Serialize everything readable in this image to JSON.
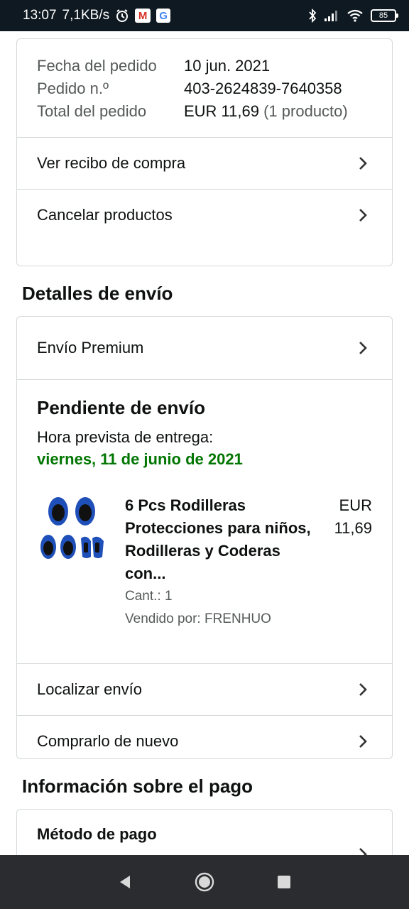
{
  "status_bar": {
    "time": "13:07",
    "speed": "7,1KB/s",
    "battery": "85",
    "icons": [
      "alarm-icon",
      "gmail-icon",
      "google-icon",
      "bluetooth-icon",
      "signal-icon",
      "wifi-icon",
      "battery-icon"
    ]
  },
  "order": {
    "date_label": "Fecha del pedido",
    "date_value": "10 jun. 2021",
    "number_label": "Pedido n.º",
    "number_value": "403-2624839-7640358",
    "total_label": "Total del pedido",
    "total_value": "EUR 11,69",
    "total_count": "(1 producto)",
    "links": [
      "Ver recibo de compra",
      "Cancelar productos"
    ]
  },
  "shipping": {
    "section_title": "Detalles de envío",
    "premium_label": "Envío Premium",
    "status": "Pendiente de envío",
    "delivery_label": "Hora prevista de entrega:",
    "delivery_date": "viernes, 11 de junio de 2021",
    "item": {
      "title": "6 Pcs Rodilleras Protecciones para niños, Rodilleras y Coderas con...",
      "quantity": "Cant.: 1",
      "seller": "Vendido por: FRENHUO",
      "price_currency": "EUR",
      "price_value": "11,69"
    },
    "links": [
      "Localizar envío",
      "Comprarlo de nuevo"
    ]
  },
  "payment": {
    "section_title": "Información sobre el pago",
    "method_label": "Método de pago"
  },
  "colors": {
    "accent_green": "#007600",
    "text": "#0f1111",
    "muted": "#565959",
    "border": "#d5d9d9",
    "status_bar": "#0f1921",
    "nav_bar": "#2a2c2f",
    "product_blue": "#1f4fb8"
  }
}
